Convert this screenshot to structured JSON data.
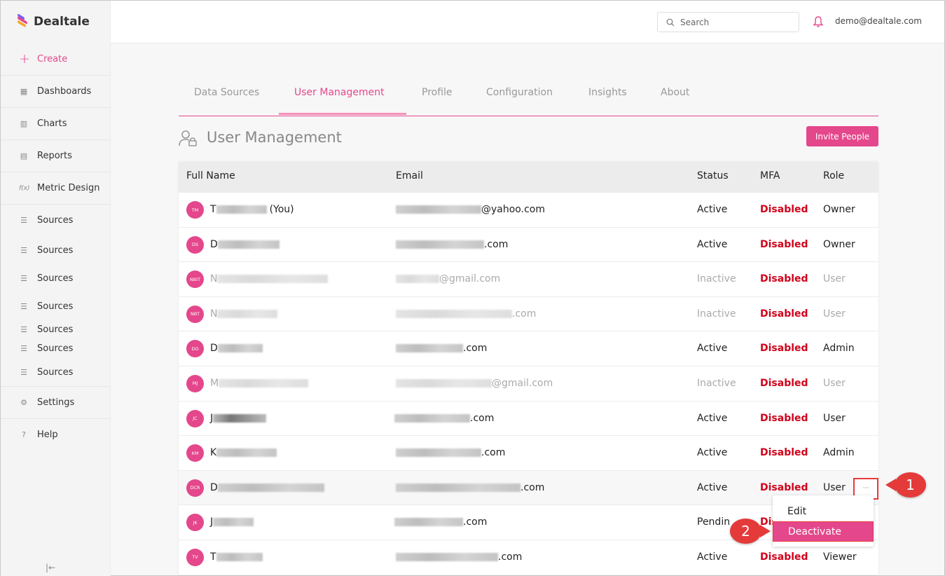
{
  "app": {
    "name": "Dealtale"
  },
  "sidebar": {
    "items": [
      {
        "label": "Create",
        "icon": "plus-icon"
      },
      {
        "label": "Dashboards",
        "icon": "dashboard-icon"
      },
      {
        "label": "Charts",
        "icon": "chart-icon"
      },
      {
        "label": "Reports",
        "icon": "document-icon"
      },
      {
        "label": "Metric Design",
        "icon": "function-icon"
      },
      {
        "label": "Sources",
        "icon": "database-icon"
      },
      {
        "label": "Sources",
        "icon": "database-icon"
      },
      {
        "label": "Sources",
        "icon": "database-icon"
      },
      {
        "label": "Sources",
        "icon": "database-icon"
      },
      {
        "label": "Sources",
        "icon": "database-icon"
      },
      {
        "label": "Sources",
        "icon": "database-icon"
      },
      {
        "label": "Sources",
        "icon": "database-icon"
      },
      {
        "label": "Settings",
        "icon": "gear-icon"
      },
      {
        "label": "Help",
        "icon": "help-icon"
      }
    ]
  },
  "header": {
    "search_placeholder": "Search",
    "user_email": "demo@dealtale.com"
  },
  "tabs": [
    {
      "label": "Data Sources"
    },
    {
      "label": "User Management"
    },
    {
      "label": "Profile"
    },
    {
      "label": "Configuration"
    },
    {
      "label": "Insights"
    },
    {
      "label": "About"
    }
  ],
  "page": {
    "title": "User Management",
    "invite_label": "Invite People"
  },
  "table": {
    "columns": [
      "Full Name",
      "Email",
      "Status",
      "MFA",
      "Role"
    ],
    "rows": [
      {
        "initials": "TM",
        "name_prefix": "T",
        "name_suffix": "(You)",
        "email_suffix": "@yahoo.com",
        "status": "Active",
        "mfa": "Disabled",
        "role": "Owner"
      },
      {
        "initials": "DS",
        "name_prefix": "D",
        "name_suffix": "",
        "email_suffix": ".com",
        "status": "Active",
        "mfa": "Disabled",
        "role": "Owner"
      },
      {
        "initials": "NBIT",
        "name_prefix": "N",
        "name_suffix": "",
        "email_suffix": "@gmail.com",
        "status": "Inactive",
        "mfa": "Disabled",
        "role": "User"
      },
      {
        "initials": "NBT",
        "name_prefix": "N",
        "name_suffix": "",
        "email_suffix": ".com",
        "status": "Inactive",
        "mfa": "Disabled",
        "role": "User"
      },
      {
        "initials": "DO",
        "name_prefix": "D",
        "name_suffix": "",
        "email_suffix": ".com",
        "status": "Active",
        "mfa": "Disabled",
        "role": "Admin"
      },
      {
        "initials": "MJ",
        "name_prefix": "M",
        "name_suffix": "",
        "email_suffix": "@gmail.com",
        "status": "Inactive",
        "mfa": "Disabled",
        "role": "User"
      },
      {
        "initials": "JC",
        "name_prefix": "J",
        "name_suffix": "",
        "email_suffix": ".com",
        "status": "Active",
        "mfa": "Disabled",
        "role": "User"
      },
      {
        "initials": "KM",
        "name_prefix": "K",
        "name_suffix": "",
        "email_suffix": ".com",
        "status": "Active",
        "mfa": "Disabled",
        "role": "Admin"
      },
      {
        "initials": "DCR",
        "name_prefix": "D",
        "name_suffix": "",
        "email_suffix": ".com",
        "status": "Active",
        "mfa": "Disabled",
        "role": "User"
      },
      {
        "initials": "JK",
        "name_prefix": "J",
        "name_suffix": "",
        "email_suffix": ".com",
        "status": "Pendin",
        "mfa": "Dis",
        "role": ""
      },
      {
        "initials": "TV",
        "name_prefix": "T",
        "name_suffix": "",
        "email_suffix": ".com",
        "status": "Active",
        "mfa": "Disabled",
        "role": "Viewer"
      }
    ]
  },
  "row_menu": {
    "trigger_label": "···",
    "items": [
      {
        "label": "Edit"
      },
      {
        "label": "Deactivate"
      }
    ]
  },
  "callouts": [
    {
      "label": "1"
    },
    {
      "label": "2"
    }
  ],
  "colors": {
    "accent": "#e4478b",
    "danger": "#d0021b",
    "callout": "#e43a3a"
  }
}
